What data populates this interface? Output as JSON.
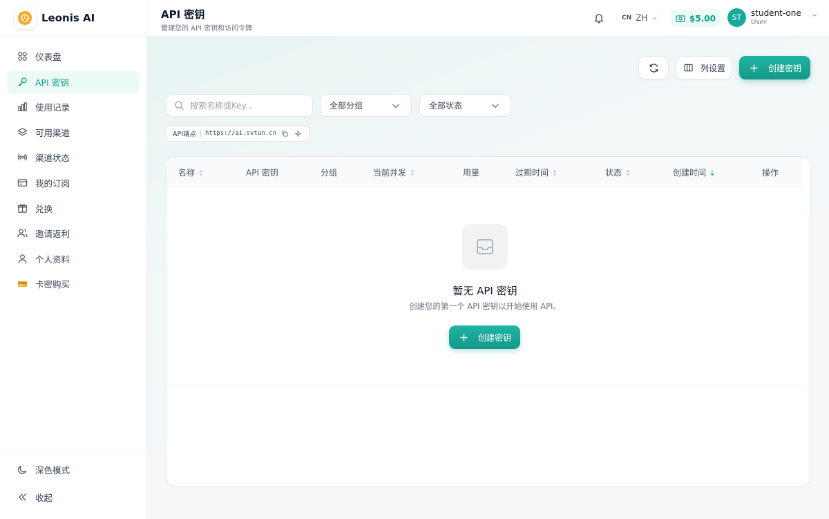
{
  "brand": {
    "name": "Leonis AI"
  },
  "sidebar": {
    "items": [
      {
        "label": "仪表盘",
        "icon": "grid-icon",
        "active": false
      },
      {
        "label": "API 密钥",
        "icon": "key-icon",
        "active": true
      },
      {
        "label": "使用记录",
        "icon": "bar-chart-icon",
        "active": false
      },
      {
        "label": "可用渠道",
        "icon": "layers-icon",
        "active": false
      },
      {
        "label": "渠道状态",
        "icon": "broadcast-icon",
        "active": false
      },
      {
        "label": "我的订阅",
        "icon": "credit-card-icon",
        "active": false
      },
      {
        "label": "兑换",
        "icon": "gift-icon",
        "active": false
      },
      {
        "label": "邀请返利",
        "icon": "users-icon",
        "active": false
      },
      {
        "label": "个人资料",
        "icon": "user-icon",
        "active": false
      },
      {
        "label": "卡密购买",
        "icon": "card-emoji-icon",
        "active": false
      }
    ],
    "bottom": [
      {
        "label": "深色模式",
        "icon": "moon-icon"
      },
      {
        "label": "收起",
        "icon": "double-chevron-left-icon"
      }
    ]
  },
  "header": {
    "title": "API 密钥",
    "subtitle": "管理您的 API 密钥和访问令牌",
    "lang_flag": "CN",
    "lang_code": "ZH",
    "balance": "$5.00",
    "user": {
      "initials": "ST",
      "name": "student-one",
      "role": "User"
    }
  },
  "toolbar": {
    "refresh_icon": "refresh-icon",
    "columns_label": "列设置",
    "create_label": "创建密钥"
  },
  "filters": {
    "search_placeholder": "搜索名称或Key...",
    "group_value": "全部分组",
    "status_value": "全部状态"
  },
  "endpoint": {
    "label": "API端点",
    "url": "https://ai.svtun.cn"
  },
  "table": {
    "columns": [
      "名称",
      "API 密钥",
      "分组",
      "当前并发",
      "用量",
      "过期时间",
      "状态",
      "创建时间",
      "操作"
    ],
    "empty_title": "暂无 API 密钥",
    "empty_desc": "创建您的第一个 API 密钥以开始使用 API。",
    "empty_create_label": "创建密钥"
  },
  "colors": {
    "accent": "#13998a",
    "accent_bg": "#ecfaf6"
  }
}
